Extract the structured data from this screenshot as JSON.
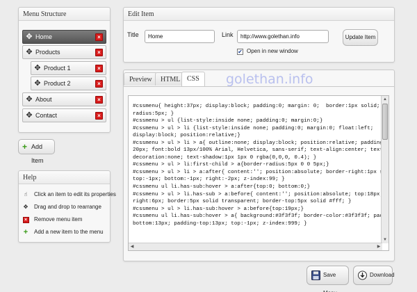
{
  "menu_structure": {
    "title": "Menu Structure",
    "items": [
      {
        "label": "Home",
        "active": true
      },
      {
        "label": "Products",
        "active": false
      },
      {
        "label": "Product 1",
        "active": false
      },
      {
        "label": "Product 2",
        "active": false
      },
      {
        "label": "About",
        "active": false
      },
      {
        "label": "Contact",
        "active": false
      }
    ],
    "add_item_label": "Add Item"
  },
  "help": {
    "title": "Help",
    "rows": [
      {
        "icon": "pointer-hand-icon",
        "text": "Click an item to edit its properties"
      },
      {
        "icon": "move-arrows-icon",
        "text": "Drag and drop to rearrange"
      },
      {
        "icon": "remove-icon",
        "text": "Remove menu item"
      },
      {
        "icon": "add-icon",
        "text": "Add a new item to the menu"
      }
    ]
  },
  "edit_item": {
    "title": "Edit Item",
    "title_label": "Title",
    "title_value": "Home",
    "link_label": "Link",
    "link_value": "http://www.golethan.info",
    "open_new_window_label": "Open in new window",
    "open_new_window_checked": true,
    "update_button": "Update Item"
  },
  "tabs": {
    "items": [
      "Preview",
      "HTML",
      "CSS"
    ],
    "active": "CSS",
    "watermark": "golethan.info"
  },
  "css_code": [
    "#cssmenu{ height:37px; display:block; padding:0; margin: 0;  border:1px solid; border-",
    "radius:5px; }",
    "#cssmenu > ul {list-style:inside none; padding:0; margin:0;}",
    "#cssmenu > ul > li {list-style:inside none; padding:0; margin:0; float:left;",
    "display:block; position:relative;}",
    "#cssmenu > ul > li > a{ outline:none; display:block; position:relative; padding:12px",
    "20px; font:bold 13px/100% Arial, Helvetica, sans-serif; text-align:center; text-",
    "decoration:none; text-shadow:1px 1px 0 rgba(0,0,0, 0.4); }",
    "#cssmenu > ul > li:first-child > a{border-radius:5px 0 0 5px;}",
    "#cssmenu > ul > li > a:after{ content:''; position:absolute; border-right:1px solid;",
    "top:-1px; bottom:-1px; right:-2px; z-index:99; }",
    "#cssmenu ul li.has-sub:hover > a:after{top:0; bottom:0;}",
    "#cssmenu > ul > li.has-sub > a:before{ content:''; position:absolute; top:18px;",
    "right:6px; border:5px solid transparent; border-top:5px solid #fff; }",
    "#cssmenu > ul > li.has-sub:hover > a:before{top:19px;}",
    "#cssmenu ul li.has-sub:hover > a{ background:#3f3f3f; border-color:#3f3f3f; padding-",
    "bottom:13px; padding-top:13px; top:-1px; z-index:999; }"
  ],
  "actions": {
    "save_menu": "Save Menu",
    "download": "Download"
  },
  "colors": {
    "active_item": "#555555",
    "delete_red": "#d81b1b",
    "add_green": "#3a9b18",
    "watermark": "#b9c0ee"
  }
}
